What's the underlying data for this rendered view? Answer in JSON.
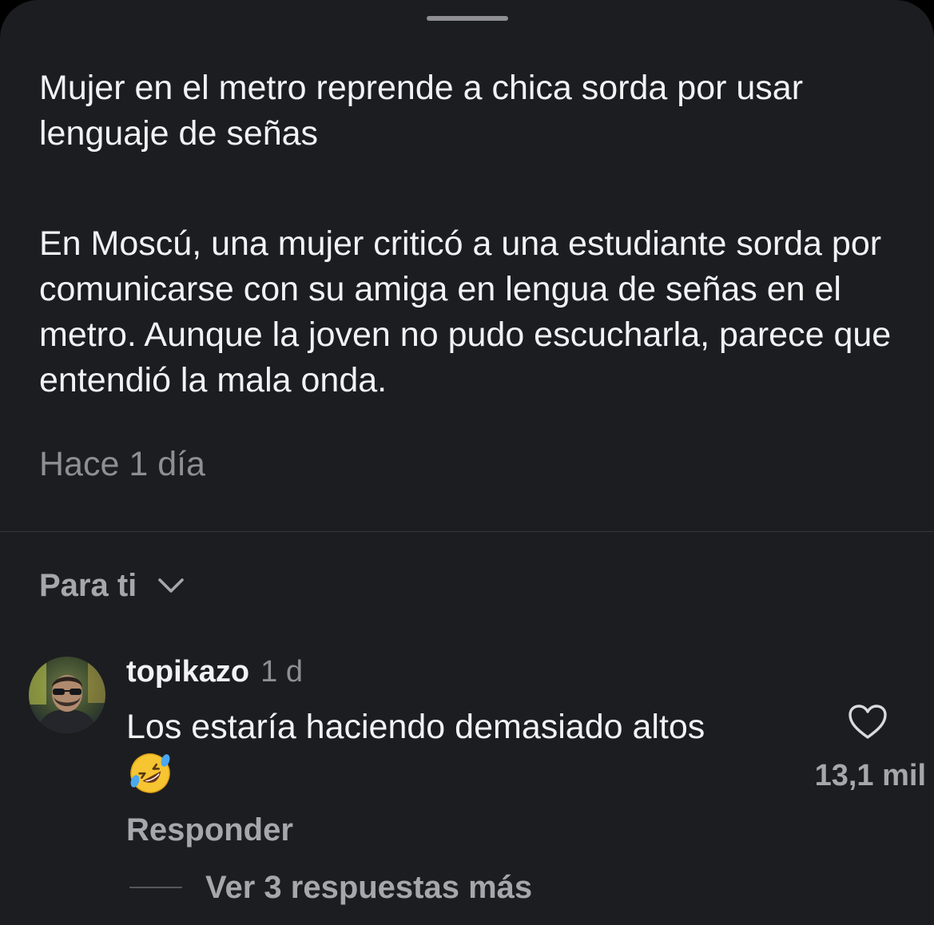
{
  "post": {
    "title": "Mujer en el metro reprende a chica sorda por usar lenguaje de señas",
    "description": "En Moscú, una mujer criticó a una estudiante sorda por comunicarse con su amiga en lengua de señas en el metro. Aunque la joven no pudo escucharla, parece que entendió la mala onda.",
    "timestamp": "Hace 1 día"
  },
  "comments_section": {
    "sort_label": "Para ti",
    "sort_icon": "chevron-down-icon"
  },
  "comment": {
    "username": "topikazo",
    "age": "1 d",
    "text": "Los estaría haciendo demasiado altos",
    "emoji": "rolling-on-floor-laughing-emoji",
    "like_icon": "heart-outline-icon",
    "like_count": "13,1 mil",
    "reply_label": "Responder",
    "view_replies_label": "Ver 3 respuestas más"
  },
  "colors": {
    "background": "#1c1d20",
    "primary_text": "#f2f2f4",
    "secondary_text": "#8e8f95",
    "muted_bold_text": "#a6a7ad",
    "divider": "#34363b"
  }
}
